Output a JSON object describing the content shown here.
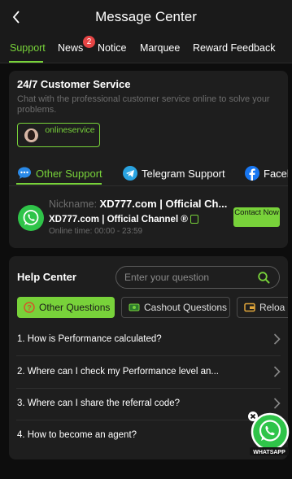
{
  "header": {
    "title": "Message Center"
  },
  "tabs": [
    {
      "label": "Support"
    },
    {
      "label": "News"
    },
    {
      "label": "Notice"
    },
    {
      "label": "Marquee"
    },
    {
      "label": "Reward Feedback"
    }
  ],
  "news_badge": "2",
  "customer_service": {
    "title": "24/7 Customer Service",
    "description": "Chat with the professional customer service online to solve your problems.",
    "online_service_label": "onlineservice"
  },
  "sub_tabs": [
    {
      "label": "Other Support",
      "icon": "chat-bubble-icon"
    },
    {
      "label": "Telegram Support",
      "icon": "telegram-icon"
    },
    {
      "label": "Facel",
      "icon": "facebook-icon"
    }
  ],
  "contact": {
    "nickname_label": "Nickname:",
    "nickname_value": "XD777.com | Official Ch...",
    "channel": "XD777.com | Official Channel ®",
    "online_time": "Online time: 00:00 - 23:59",
    "contact_button": "Contact Now"
  },
  "help_center": {
    "title": "Help Center",
    "search_placeholder": "Enter your question",
    "categories": [
      {
        "label": "Other Questions"
      },
      {
        "label": "Cashout Questions"
      },
      {
        "label": "Reloa"
      }
    ],
    "questions": [
      "1. How is Performance calculated?",
      "2. Where can I check my Performance level an...",
      "3. Where can I share the referral code?",
      "4. How to become an agent?"
    ]
  },
  "floating_whatsapp": {
    "label": "WHATSAPP"
  },
  "colors": {
    "accent": "#78d23a",
    "background": "#0d0d0d",
    "card": "#1e1e1e",
    "badge": "#e64545",
    "whatsapp": "#2fc449"
  }
}
